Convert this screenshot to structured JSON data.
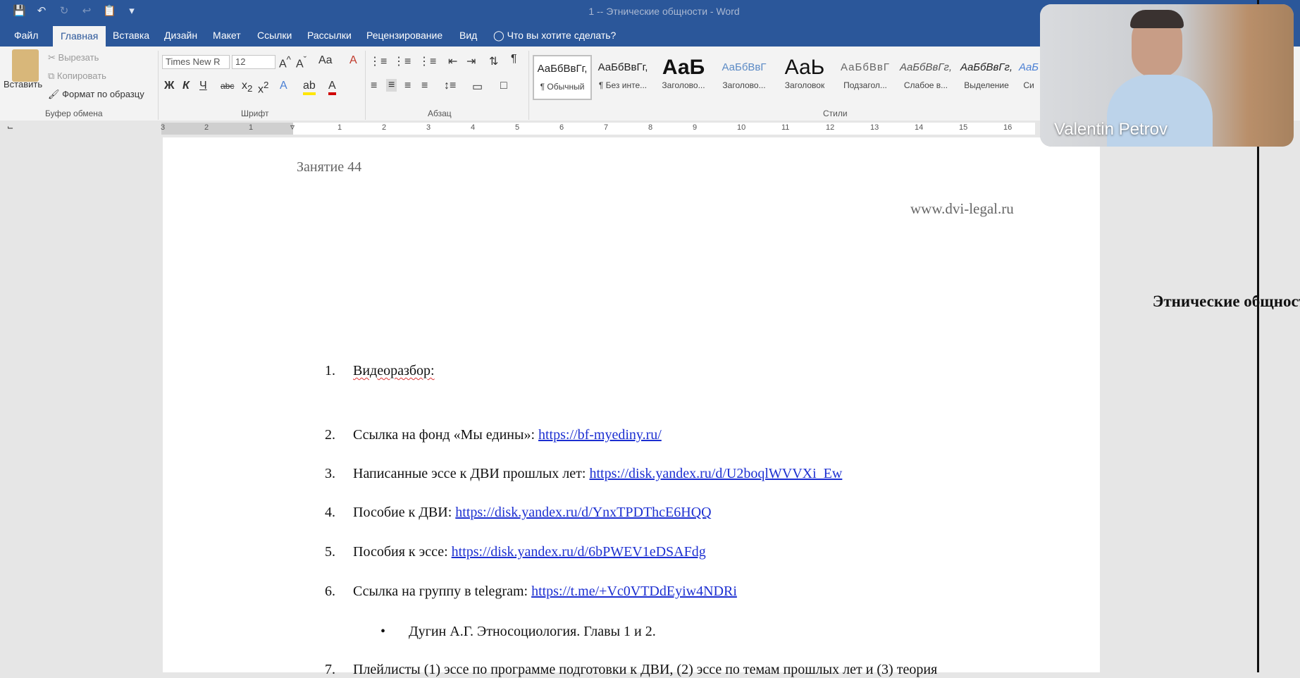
{
  "window": {
    "title": "1 -- Этнические общности - Word"
  },
  "tabs": [
    {
      "label": "Файл",
      "active": false
    },
    {
      "label": "Главная",
      "active": true
    },
    {
      "label": "Вставка",
      "active": false
    },
    {
      "label": "Дизайн",
      "active": false
    },
    {
      "label": "Макет",
      "active": false
    },
    {
      "label": "Ссылки",
      "active": false
    },
    {
      "label": "Рассылки",
      "active": false
    },
    {
      "label": "Рецензирование",
      "active": false
    },
    {
      "label": "Вид",
      "active": false
    }
  ],
  "tell_me": "Что вы хотите сделать?",
  "clipboard": {
    "paste": "Вставить",
    "cut": "Вырезать",
    "copy": "Копировать",
    "format_painter": "Формат по образцу",
    "label": "Буфер обмена"
  },
  "font": {
    "name": "Times New R",
    "size": "12",
    "bold": "Ж",
    "italic": "К",
    "underline": "Ч",
    "strike": "abc",
    "label": "Шрифт"
  },
  "paragraph": {
    "label": "Абзац"
  },
  "styles": {
    "label": "Стили",
    "items": [
      {
        "preview": "АаБбВвГг,",
        "name": "¶ Обычный"
      },
      {
        "preview": "АаБбВвГг,",
        "name": "¶ Без инте..."
      },
      {
        "preview": "АаБ",
        "name": "Заголово..."
      },
      {
        "preview": "АаБбВвГ",
        "name": "Заголово..."
      },
      {
        "preview": "АаЬ",
        "name": "Заголовок"
      },
      {
        "preview": "АаБбВвГ",
        "name": "Подзагол..."
      },
      {
        "preview": "АаБбВвГг,",
        "name": "Слабое в..."
      },
      {
        "preview": "АаБбВвГг,",
        "name": "Выделение"
      },
      {
        "preview": "АаБ",
        "name": "Си"
      }
    ]
  },
  "ruler": {
    "numbers": [
      "3",
      "2",
      "1",
      "1",
      "2",
      "3",
      "4",
      "5",
      "6",
      "7",
      "8",
      "9",
      "10",
      "11",
      "12",
      "13",
      "14",
      "15",
      "16"
    ]
  },
  "document": {
    "lesson": "Занятие 44",
    "site": "www.dvi-legal.ru",
    "heading": "Этнические общности",
    "items": [
      {
        "num": "1.",
        "text": "Видеоразбор:",
        "link": ""
      },
      {
        "num": "2.",
        "text": "Ссылка на фонд «Мы едины»: ",
        "link": "https://bf-myediny.ru/"
      },
      {
        "num": "3.",
        "text": "Написанные эссе к ДВИ прошлых лет: ",
        "link": "https://disk.yandex.ru/d/U2boqlWVVXi_Ew"
      },
      {
        "num": "4.",
        "text": "Пособие к ДВИ: ",
        "link": "https://disk.yandex.ru/d/YnxTPDThcE6HQQ"
      },
      {
        "num": "5.",
        "text": "Пособия к эссе: ",
        "link": "https://disk.yandex.ru/d/6bPWEV1eDSAFdg"
      },
      {
        "num": "6.",
        "text": "Ссылка на группу в telegram: ",
        "link": "https://t.me/+Vc0VTDdEyiw4NDRi"
      }
    ],
    "bullet": "Дугин А.Г. Этносоциология. Главы 1 и 2.",
    "item7": {
      "num": "7.",
      "text": "Плейлисты (1) эссе по программе подготовки к ДВИ, (2) эссе по темам прошлых лет и (3) теория"
    }
  },
  "video": {
    "participant": "Valentin Petrov"
  }
}
